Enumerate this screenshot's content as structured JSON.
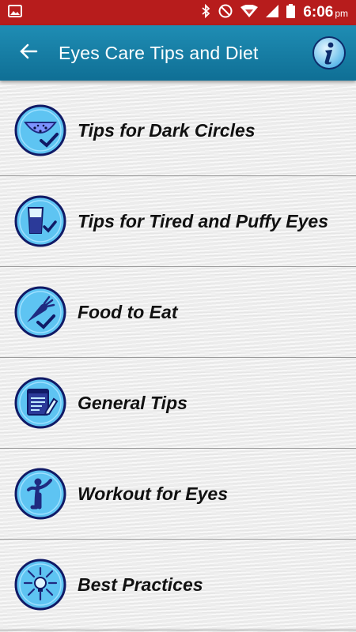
{
  "status_bar": {
    "time": "6:06",
    "ampm": "pm",
    "icons": [
      "image-icon",
      "bluetooth-icon",
      "do-not-disturb-icon",
      "wifi-icon",
      "signal-icon",
      "battery-icon"
    ]
  },
  "app_bar": {
    "title": "Eyes Care Tips and Diet",
    "back_icon": "arrow-left-icon",
    "info_icon": "info-icon"
  },
  "menu": {
    "items": [
      {
        "label": "Tips for Dark Circles",
        "icon": "watermelon-check-icon"
      },
      {
        "label": "Tips for Tired and Puffy Eyes",
        "icon": "glass-water-icon"
      },
      {
        "label": "Food to Eat",
        "icon": "carrot-check-icon"
      },
      {
        "label": "General Tips",
        "icon": "notepad-pencil-icon"
      },
      {
        "label": "Workout for Eyes",
        "icon": "stretching-person-icon"
      },
      {
        "label": "Best Practices",
        "icon": "lightbulb-ideas-icon"
      }
    ]
  },
  "colors": {
    "status_bar": "#b71c1c",
    "app_bar": "#1a84ad",
    "icon_ring": "#1a237e",
    "icon_fill": "#4fc3f7"
  }
}
